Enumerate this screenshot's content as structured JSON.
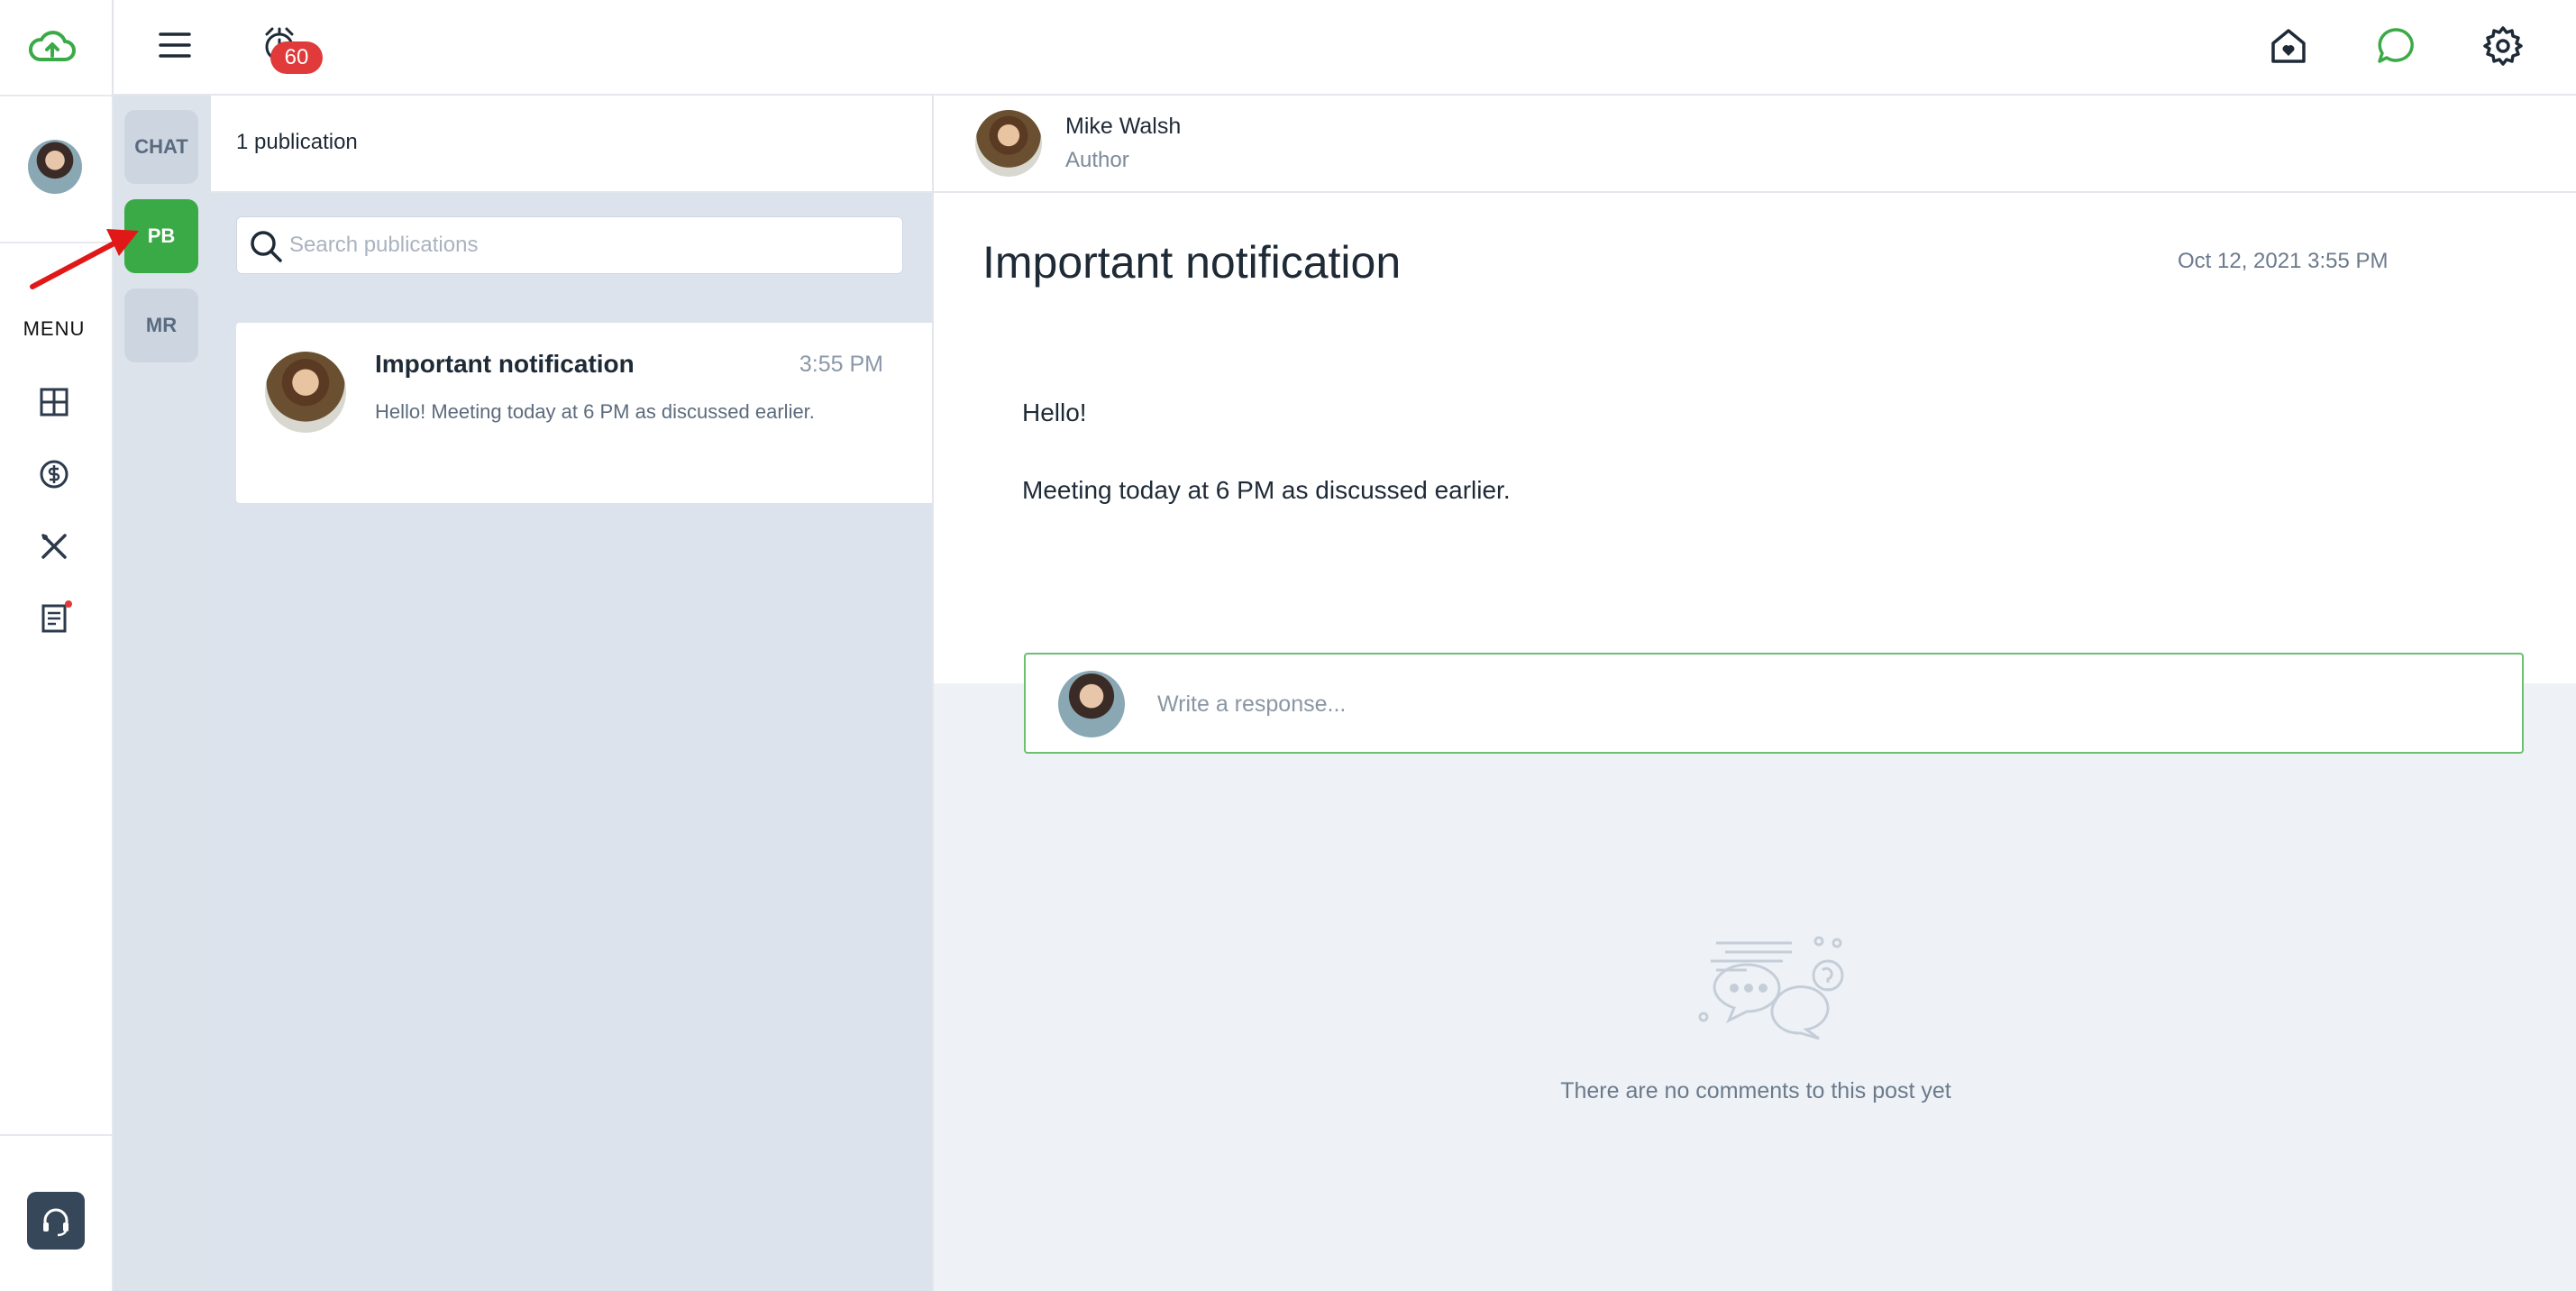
{
  "rail": {
    "logo_icon": "cloud-upload-icon",
    "menu_label": "MENU",
    "nav_icons": [
      "dashboard-icon",
      "dollar-circle-icon",
      "tools-icon",
      "document-icon"
    ],
    "support_icon": "headset-icon"
  },
  "topbar": {
    "menu_icon": "hamburger-icon",
    "alarm_icon": "alarm-clock-icon",
    "alarm_badge": "60",
    "right_icons": [
      "home-icon",
      "chat-bubble-icon",
      "gear-icon"
    ]
  },
  "tabs": [
    {
      "label": "CHAT",
      "active": false
    },
    {
      "label": "PB",
      "active": true
    },
    {
      "label": "MR",
      "active": false
    }
  ],
  "publications": {
    "count_label": "1 publication",
    "search_placeholder": "Search publications",
    "items": [
      {
        "title": "Important notification",
        "time": "3:55 PM",
        "preview": "Hello! Meeting today at 6 PM as discussed earlier."
      }
    ]
  },
  "detail": {
    "author_name": "Mike Walsh",
    "author_role": "Author",
    "post_title": "Important notification",
    "post_date": "Oct 12, 2021 3:55 PM",
    "body_line1": "Hello!",
    "body_line2": "Meeting today at 6 PM as discussed earlier.",
    "response_placeholder": "Write a response...",
    "empty_text": "There are no comments to this post yet"
  },
  "colors": {
    "accent_green": "#3aaa47",
    "badge_red": "#e03a3a",
    "panel_bg": "#dce3ec",
    "annotation_arrow": "#e01818"
  }
}
